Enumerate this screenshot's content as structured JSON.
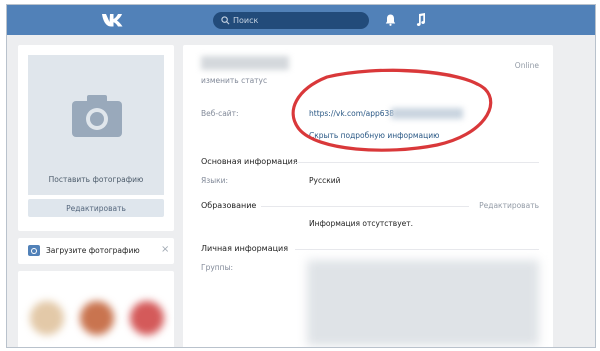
{
  "header": {
    "logo_icon": "vk-logo-icon",
    "search_placeholder": "Поиск",
    "icons": [
      "search-icon",
      "bell-icon",
      "music-icon"
    ],
    "brand_color": "#5181b8"
  },
  "left": {
    "photo_label": "Поставить фотографию",
    "edit_label": "Редактировать",
    "upload_label": "Загрузите фотографию",
    "close_glyph": "×"
  },
  "profile": {
    "change_status": "изменить статус",
    "online": "Online",
    "website_label": "Веб-сайт:",
    "website_value": "https://vk.com/app638",
    "show_more": "Скрыть подробную информацию",
    "basic_title": "Основная информация",
    "languages_label": "Языки:",
    "languages_value": "Русский",
    "education_title": "Образование",
    "education_edit": "Редактировать",
    "education_empty": "Информация отсутствует.",
    "personal_title": "Личная информация",
    "groups_label": "Группы:"
  },
  "annotation": {
    "highlight_color": "#d9383a"
  }
}
